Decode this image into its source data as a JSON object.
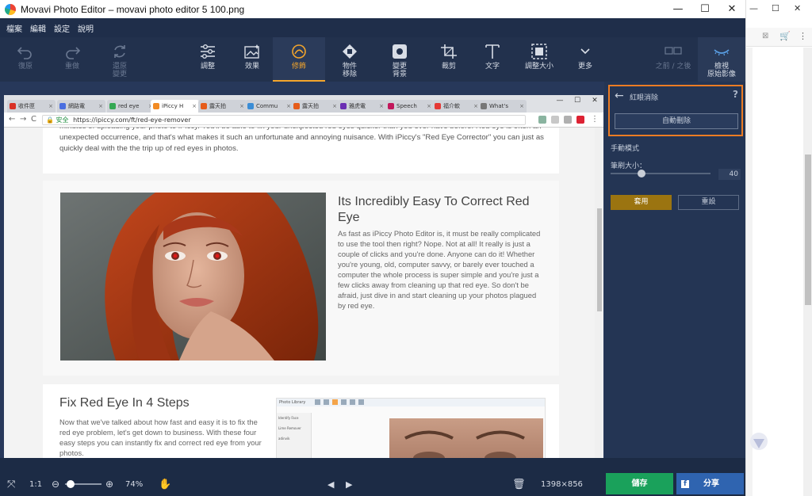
{
  "window": {
    "title": "Movavi Photo Editor – movavi photo editor 5 100.png",
    "min": "—",
    "max": "☐",
    "close": "✕"
  },
  "menu": [
    "檔案",
    "編輯",
    "設定",
    "說明"
  ],
  "toolbar": {
    "undo": "復原",
    "redo": "重做",
    "restore_1": "還原",
    "restore_2": "變更",
    "adjust": "調整",
    "effects": "效果",
    "retouch": "修飾",
    "remove_1": "物件",
    "remove_2": "移除",
    "bg_1": "變更",
    "bg_2": "背景",
    "crop": "裁剪",
    "text": "文字",
    "resize": "調整大小",
    "more": "更多",
    "before_after": "之前 / 之後",
    "view_1": "檢視",
    "view_2": "原始影像"
  },
  "panel": {
    "title": "紅眼消除",
    "help": "?",
    "auto_button": "自動刪除",
    "manual_label": "手動模式",
    "brush_label": "筆刷大小：",
    "brush_value": "40",
    "brush_fraction": 0.31,
    "apply_button": "套用",
    "reset_button": "重設"
  },
  "browser": {
    "tabs": [
      {
        "label": "收件匣",
        "color": "#d93025"
      },
      {
        "label": "網路電",
        "color": "#4a6ee0"
      },
      {
        "label": "red eye",
        "color": "#34a853"
      },
      {
        "label": "iPiccy H",
        "color": "#f28b24"
      },
      {
        "label": "露天拍",
        "color": "#e65c1a"
      },
      {
        "label": "Commu",
        "color": "#3b8dd6"
      },
      {
        "label": "露天拍",
        "color": "#e65c1a"
      },
      {
        "label": "雅虎電",
        "color": "#6b2fb3"
      },
      {
        "label": "Speech",
        "color": "#c2185b"
      },
      {
        "label": "福介軟",
        "color": "#e53935"
      },
      {
        "label": "What's",
        "color": "#777777"
      }
    ],
    "secure_label": "安全",
    "url": "https://ipiccy.com/ft/red-eye-remover"
  },
  "webpage": {
    "intro_text": "minutes of uploading your photo to iPiccy. You'll be able to fix your unexpected red eyes quicker than you ever have before. Red eye is often an unexpected occurrence, and that's what makes it such an unfortunate and annoying nuisance. With iPiccy's \"Red Eye Corrector\" you can just as quickly deal with the the trip up of red eyes in photos.",
    "heading1": "Its Incredibly Easy To Correct Red Eye",
    "para1": "As fast as iPiccy Photo Editor is, it must be really complicated to use the tool then right? Nope. Not at all! It really is just a couple of clicks and you're done. Anyone can do it! Whether you're young, old, computer savvy, or barely ever touched a computer the whole process is super simple and you're just a few clicks away from cleaning up that red eye. So don't be afraid, just dive in and start cleaning up your photos plagued by red eye.",
    "heading2": "Fix Red Eye In 4 Steps",
    "para2": "Now that we've talked about how fast and easy it is to fix the red eye problem, let's get down to business. With these four easy steps you can instantly fix and correct red eye from your photos.",
    "thumb_title": "Photo Library",
    "thumb_items": [
      "Identify Face",
      "Lime Remover",
      "adinvik"
    ]
  },
  "status": {
    "ratio": "1:1",
    "zoom": "74%",
    "zoom_fraction": 0.1,
    "dimensions": "1398×856",
    "save": "儲存",
    "share": "分享"
  },
  "bg_window": {
    "min": "—",
    "max": "☐",
    "close": "✕"
  },
  "colors": {
    "accent": "#f3a52c",
    "highlight_box": "#ec7c24",
    "save": "#1aa15b",
    "share": "#2f64b0",
    "apply": "#9b7410"
  }
}
